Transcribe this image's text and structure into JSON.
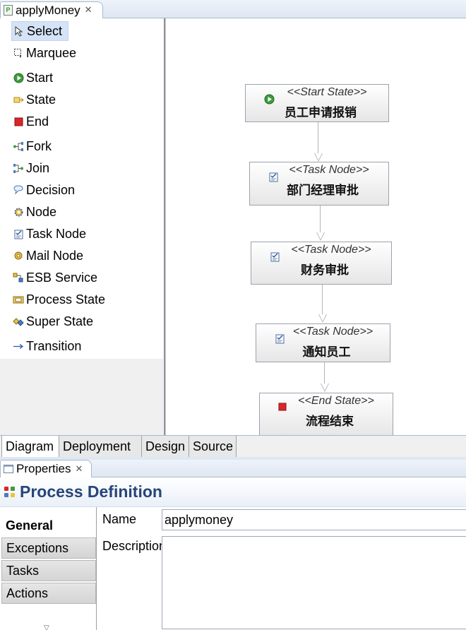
{
  "editor": {
    "tab_title": "applyMoney"
  },
  "palette": {
    "items": [
      {
        "label": "Select",
        "icon": "arrow-pointer-icon"
      },
      {
        "label": "Marquee",
        "icon": "marquee-icon"
      },
      {
        "label": "Start",
        "icon": "start-state-icon"
      },
      {
        "label": "State",
        "icon": "state-icon"
      },
      {
        "label": "End",
        "icon": "end-state-icon"
      },
      {
        "label": "Fork",
        "icon": "fork-icon"
      },
      {
        "label": "Join",
        "icon": "join-icon"
      },
      {
        "label": "Decision",
        "icon": "decision-icon"
      },
      {
        "label": "Node",
        "icon": "node-gear-icon"
      },
      {
        "label": "Task Node",
        "icon": "task-node-icon"
      },
      {
        "label": "Mail Node",
        "icon": "mail-node-icon"
      },
      {
        "label": "ESB Service",
        "icon": "esb-service-icon"
      },
      {
        "label": "Process State",
        "icon": "process-state-icon"
      },
      {
        "label": "Super State",
        "icon": "super-state-icon"
      },
      {
        "label": "Transition",
        "icon": "transition-arrow-icon"
      }
    ]
  },
  "diagram": {
    "nodes": [
      {
        "stereotype": "<<Start State>>",
        "name": "员工申请报销",
        "icon": "start-state-icon"
      },
      {
        "stereotype": "<<Task Node>>",
        "name": "部门经理审批",
        "icon": "task-node-icon"
      },
      {
        "stereotype": "<<Task Node>>",
        "name": "财务审批",
        "icon": "task-node-icon"
      },
      {
        "stereotype": "<<Task Node>>",
        "name": "通知员工",
        "icon": "task-node-icon"
      },
      {
        "stereotype": "<<End State>>",
        "name": "流程结束",
        "icon": "end-state-icon"
      }
    ]
  },
  "page_tabs": [
    "Diagram",
    "Deployment",
    "Design",
    "Source"
  ],
  "properties": {
    "view_title": "Properties",
    "header_title": "Process Definition",
    "sections": [
      "General",
      "Exceptions",
      "Tasks",
      "Actions"
    ],
    "name_label": "Name",
    "name_value": "applymoney",
    "description_label": "Description",
    "description_value": ""
  },
  "colors": {
    "start_green": "#3f9b3f",
    "end_red": "#d8262b",
    "title_blue": "#26457a",
    "selection_blue": "#d5e3f6"
  }
}
